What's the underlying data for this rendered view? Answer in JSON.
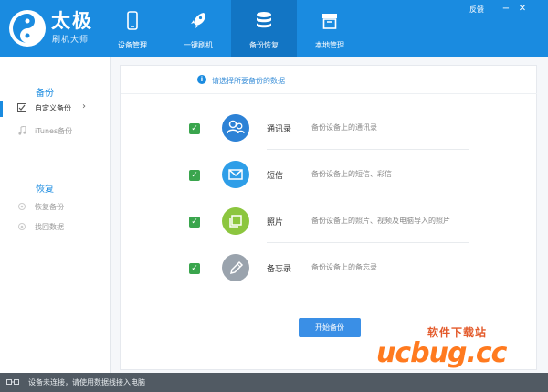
{
  "app": {
    "logo_title": "太极",
    "logo_sub": "刷机大师",
    "feedback_label": "反馈",
    "minimize_label": "−",
    "close_label": "✕"
  },
  "tabs": [
    {
      "label": "设备管理",
      "icon": "phone-icon"
    },
    {
      "label": "一键刷机",
      "icon": "rocket-icon"
    },
    {
      "label": "备份恢复",
      "icon": "database-icon",
      "active": true
    },
    {
      "label": "本地管理",
      "icon": "box-icon"
    }
  ],
  "sidebar": {
    "backup_heading": "备份",
    "items_backup": [
      {
        "label": "自定义备份",
        "icon": "checkbox-icon",
        "active": true
      },
      {
        "label": "iTunes备份",
        "icon": "music-note-icon"
      }
    ],
    "restore_heading": "恢复",
    "items_restore": [
      {
        "label": "恢复备份",
        "icon": "radio-icon"
      },
      {
        "label": "找回数据",
        "icon": "radio-icon"
      }
    ]
  },
  "main": {
    "hint_icon": "i",
    "hint": "请选择所要备份的数据",
    "rows": [
      {
        "title": "通讯录",
        "desc": "备份设备上的通讯录",
        "icon": "contacts-icon",
        "color": "#2d82d6",
        "checked": true
      },
      {
        "title": "短信",
        "desc": "备份设备上的短信、彩信",
        "icon": "mail-icon",
        "color": "#2e9ee8",
        "checked": true
      },
      {
        "title": "照片",
        "desc": "备份设备上的照片、视频及电脑导入的照片",
        "icon": "photo-icon",
        "color": "#8cc63f",
        "checked": true
      },
      {
        "title": "备忘录",
        "desc": "备份设备上的备忘录",
        "icon": "pen-icon",
        "color": "#9aa3ad",
        "checked": true
      }
    ],
    "start_button": "开始备份"
  },
  "watermark": {
    "top": "软件下载站",
    "big": "ucbug.cc"
  },
  "status": {
    "text": "设备未连接，请使用数据线接入电脑"
  },
  "colors": {
    "accent": "#1a8be0",
    "active_tab": "#1275c4",
    "check": "#3aa54d",
    "status_bg": "#515a63"
  }
}
